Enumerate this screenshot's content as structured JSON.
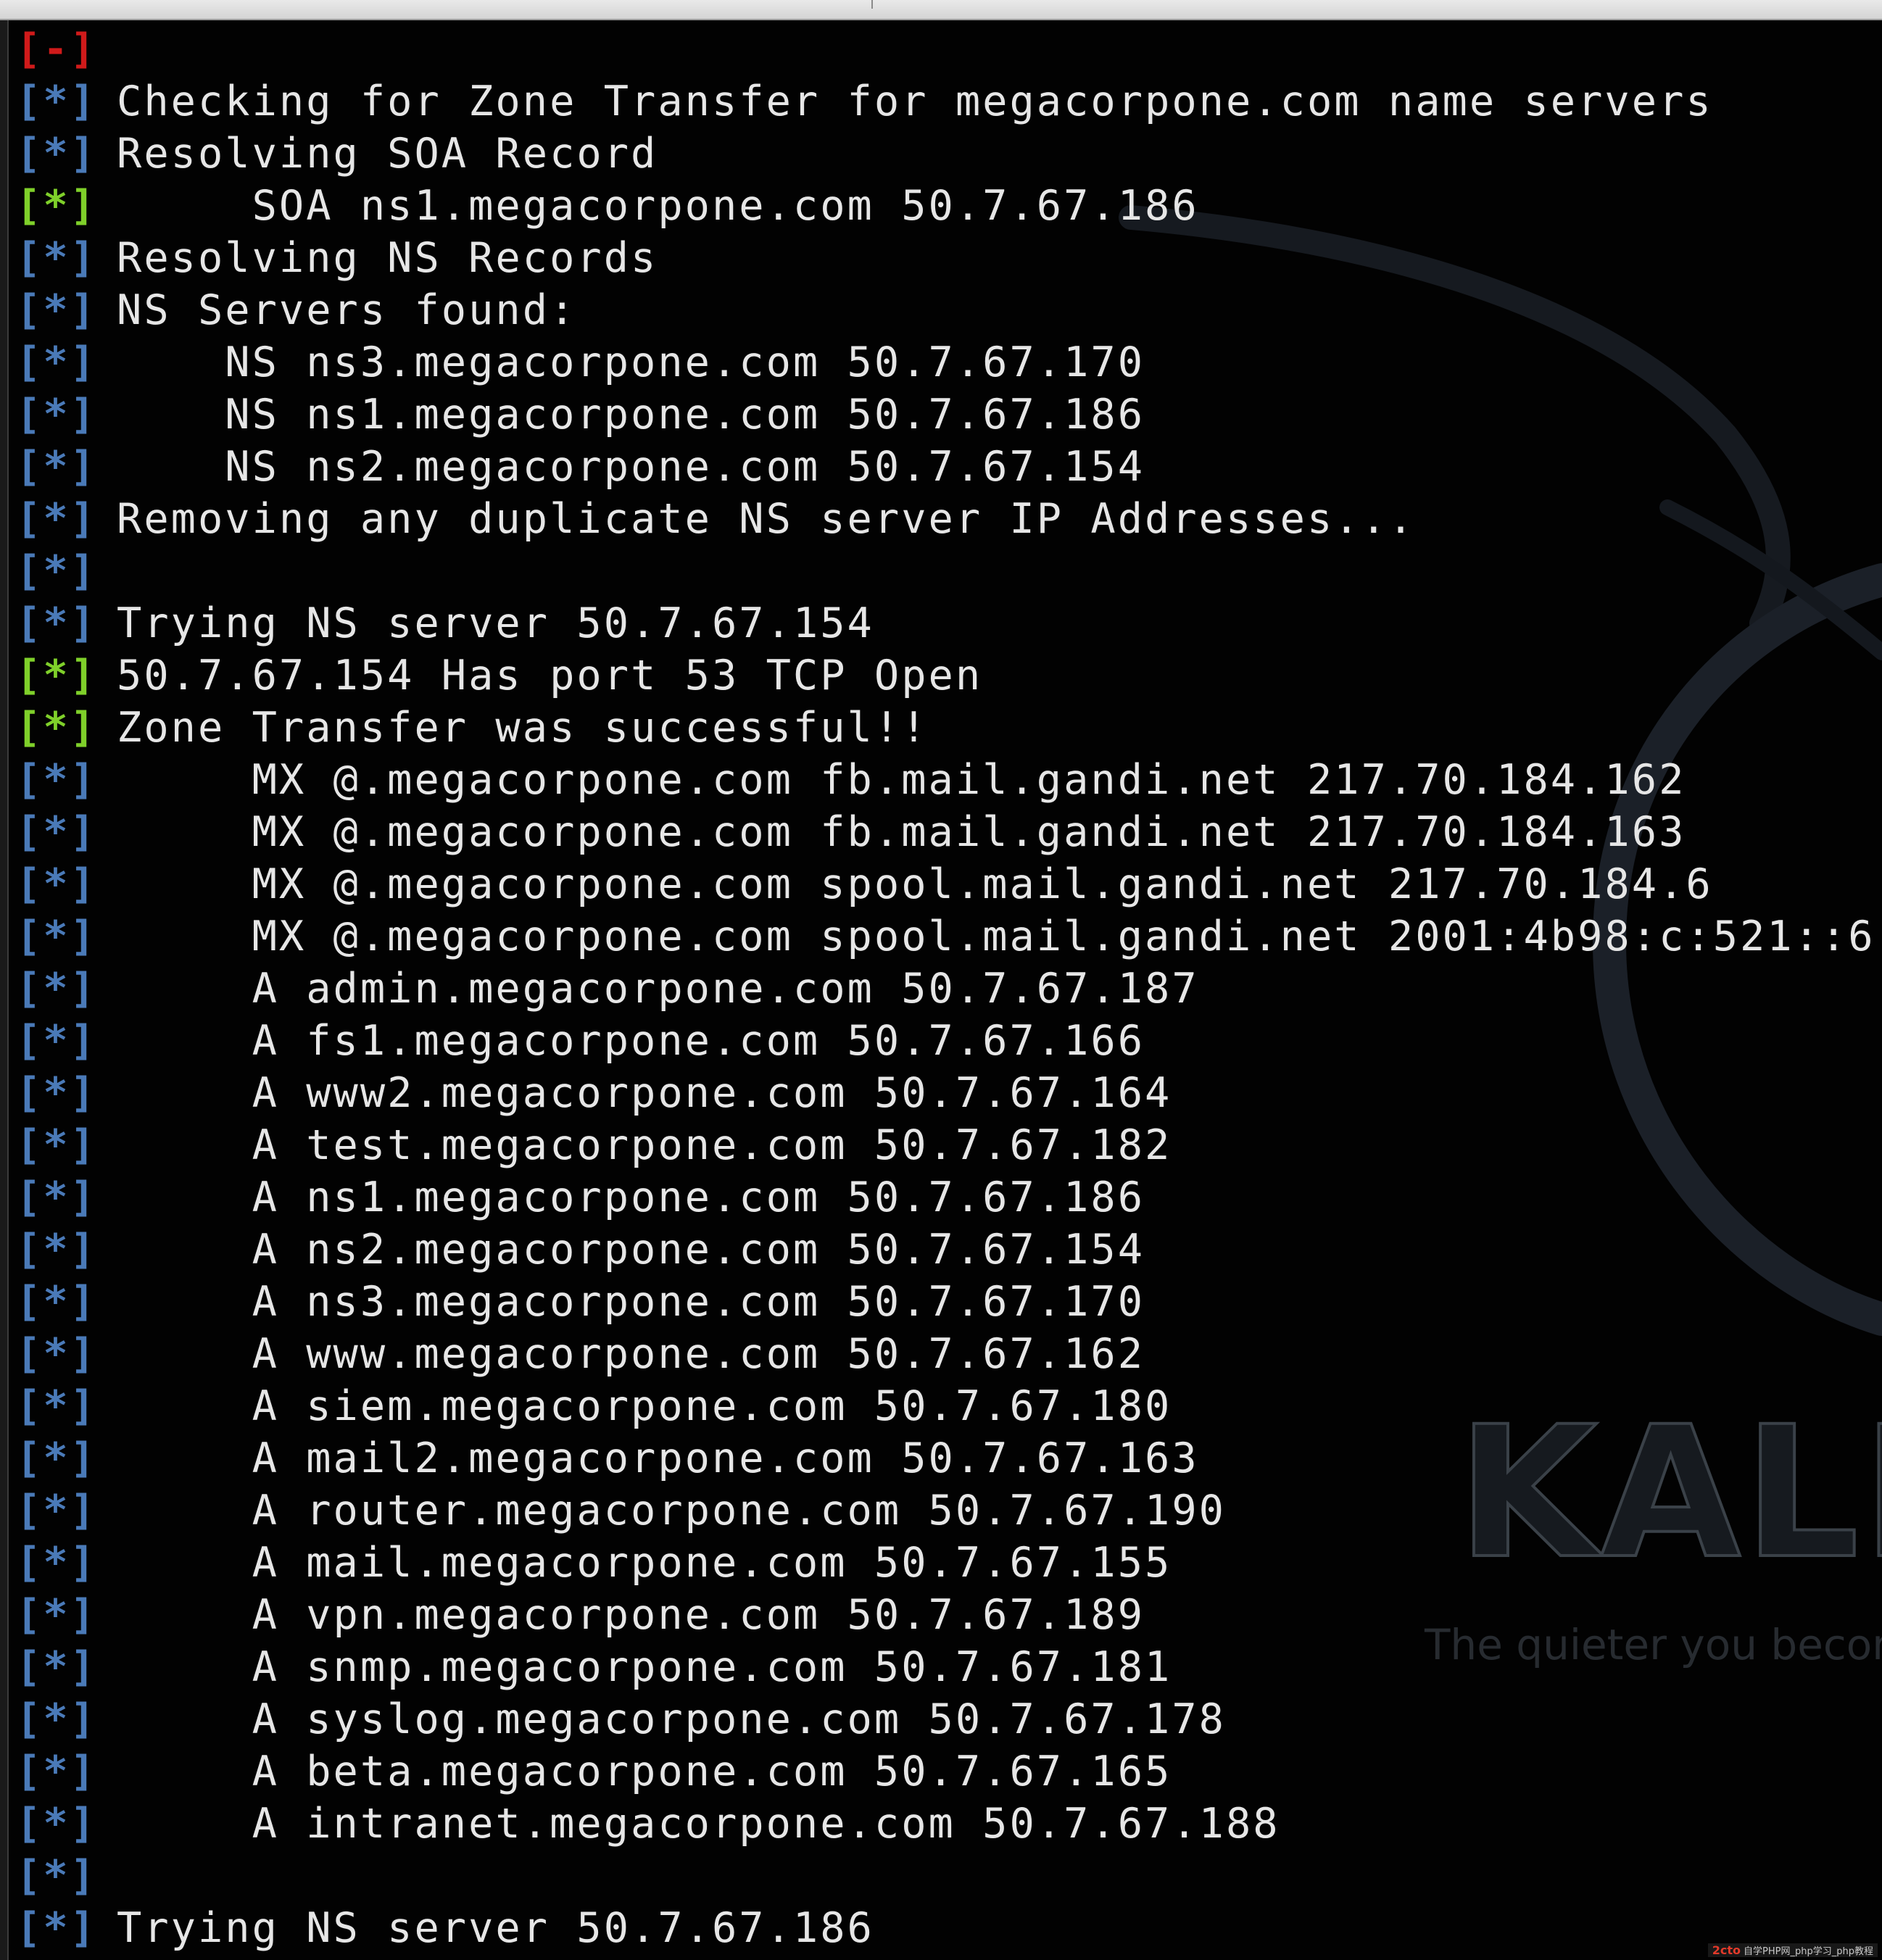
{
  "wallpaper": {
    "logo_text": "KALI",
    "tagline": "The quieter you becom"
  },
  "watermark": {
    "brand": "2cto",
    "text": "自学PHP网_php学习_php教程"
  },
  "terminal": {
    "lines": [
      {
        "status": "[-]",
        "type": "error",
        "text": ""
      },
      {
        "status": "[*]",
        "type": "info",
        "text": "Checking for Zone Transfer for megacorpone.com name servers"
      },
      {
        "status": "[*]",
        "type": "info",
        "text": "Resolving SOA Record"
      },
      {
        "status": "[*]",
        "type": "good",
        "text": "     SOA ns1.megacorpone.com 50.7.67.186"
      },
      {
        "status": "[*]",
        "type": "info",
        "text": "Resolving NS Records"
      },
      {
        "status": "[*]",
        "type": "info",
        "text": "NS Servers found:"
      },
      {
        "status": "[*]",
        "type": "info",
        "text": "    NS ns3.megacorpone.com 50.7.67.170"
      },
      {
        "status": "[*]",
        "type": "info",
        "text": "    NS ns1.megacorpone.com 50.7.67.186"
      },
      {
        "status": "[*]",
        "type": "info",
        "text": "    NS ns2.megacorpone.com 50.7.67.154"
      },
      {
        "status": "[*]",
        "type": "info",
        "text": "Removing any duplicate NS server IP Addresses..."
      },
      {
        "status": "[*]",
        "type": "info",
        "text": ""
      },
      {
        "status": "[*]",
        "type": "info",
        "text": "Trying NS server 50.7.67.154"
      },
      {
        "status": "[*]",
        "type": "good",
        "text": "50.7.67.154 Has port 53 TCP Open"
      },
      {
        "status": "[*]",
        "type": "good",
        "text": "Zone Transfer was successful!!"
      },
      {
        "status": "[*]",
        "type": "info",
        "text": "     MX @.megacorpone.com fb.mail.gandi.net 217.70.184.162"
      },
      {
        "status": "[*]",
        "type": "info",
        "text": "     MX @.megacorpone.com fb.mail.gandi.net 217.70.184.163"
      },
      {
        "status": "[*]",
        "type": "info",
        "text": "     MX @.megacorpone.com spool.mail.gandi.net 217.70.184.6"
      },
      {
        "status": "[*]",
        "type": "info",
        "text": "     MX @.megacorpone.com spool.mail.gandi.net 2001:4b98:c:521::6"
      },
      {
        "status": "[*]",
        "type": "info",
        "text": "     A admin.megacorpone.com 50.7.67.187"
      },
      {
        "status": "[*]",
        "type": "info",
        "text": "     A fs1.megacorpone.com 50.7.67.166"
      },
      {
        "status": "[*]",
        "type": "info",
        "text": "     A www2.megacorpone.com 50.7.67.164"
      },
      {
        "status": "[*]",
        "type": "info",
        "text": "     A test.megacorpone.com 50.7.67.182"
      },
      {
        "status": "[*]",
        "type": "info",
        "text": "     A ns1.megacorpone.com 50.7.67.186"
      },
      {
        "status": "[*]",
        "type": "info",
        "text": "     A ns2.megacorpone.com 50.7.67.154"
      },
      {
        "status": "[*]",
        "type": "info",
        "text": "     A ns3.megacorpone.com 50.7.67.170"
      },
      {
        "status": "[*]",
        "type": "info",
        "text": "     A www.megacorpone.com 50.7.67.162"
      },
      {
        "status": "[*]",
        "type": "info",
        "text": "     A siem.megacorpone.com 50.7.67.180"
      },
      {
        "status": "[*]",
        "type": "info",
        "text": "     A mail2.megacorpone.com 50.7.67.163"
      },
      {
        "status": "[*]",
        "type": "info",
        "text": "     A router.megacorpone.com 50.7.67.190"
      },
      {
        "status": "[*]",
        "type": "info",
        "text": "     A mail.megacorpone.com 50.7.67.155"
      },
      {
        "status": "[*]",
        "type": "info",
        "text": "     A vpn.megacorpone.com 50.7.67.189"
      },
      {
        "status": "[*]",
        "type": "info",
        "text": "     A snmp.megacorpone.com 50.7.67.181"
      },
      {
        "status": "[*]",
        "type": "info",
        "text": "     A syslog.megacorpone.com 50.7.67.178"
      },
      {
        "status": "[*]",
        "type": "info",
        "text": "     A beta.megacorpone.com 50.7.67.165"
      },
      {
        "status": "[*]",
        "type": "info",
        "text": "     A intranet.megacorpone.com 50.7.67.188"
      },
      {
        "status": "[*]",
        "type": "info",
        "text": ""
      },
      {
        "status": "[*]",
        "type": "info",
        "text": "Trying NS server 50.7.67.186"
      }
    ]
  }
}
